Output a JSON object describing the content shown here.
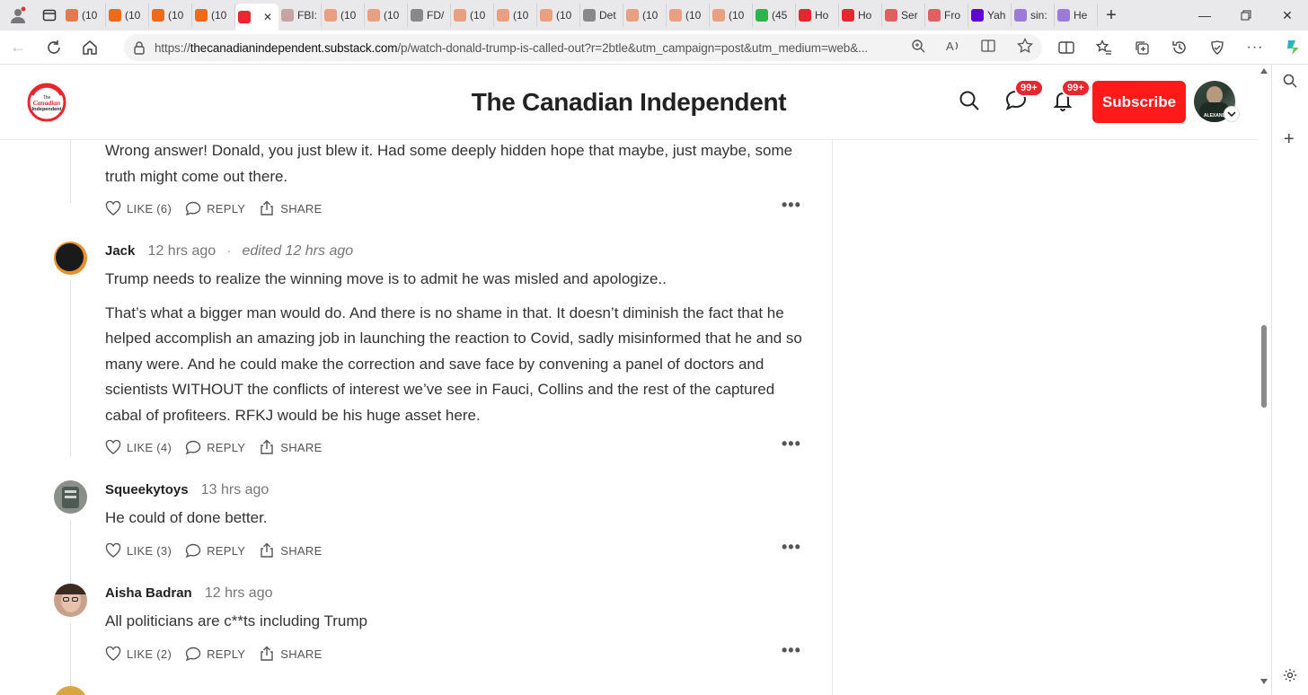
{
  "browser": {
    "tabs": [
      {
        "label": "(10",
        "icon": "substack-icon",
        "color": "#e07a4f"
      },
      {
        "label": "(10",
        "icon": "substack-icon",
        "color": "#f06a1a"
      },
      {
        "label": "(10",
        "icon": "substack-icon",
        "color": "#f06a1a"
      },
      {
        "label": "(10",
        "icon": "substack-icon",
        "color": "#f06a1a"
      },
      {
        "label": "",
        "icon": "canadian-independent-icon",
        "color": "#e8262d",
        "active": true
      },
      {
        "label": "FBI:",
        "icon": "page-icon",
        "color": "#c9a3a3"
      },
      {
        "label": "(10",
        "icon": "substack-icon",
        "color": "#e8a080"
      },
      {
        "label": "(10",
        "icon": "substack-icon",
        "color": "#e8a080"
      },
      {
        "label": "FD/",
        "icon": "link-icon",
        "color": "#888888"
      },
      {
        "label": "(10",
        "icon": "substack-icon",
        "color": "#e8a080"
      },
      {
        "label": "(10",
        "icon": "substack-icon",
        "color": "#e8a080"
      },
      {
        "label": "(10",
        "icon": "substack-icon",
        "color": "#e8a080"
      },
      {
        "label": "Det",
        "icon": "arrow-icon",
        "color": "#888888"
      },
      {
        "label": "(10",
        "icon": "substack-icon",
        "color": "#e8a080"
      },
      {
        "label": "(10",
        "icon": "substack-icon",
        "color": "#e8a080"
      },
      {
        "label": "(10",
        "icon": "substack-icon",
        "color": "#e8a080"
      },
      {
        "label": "(45",
        "icon": "g-icon",
        "color": "#2fb24c"
      },
      {
        "label": "Ho",
        "icon": "red-icon",
        "color": "#e8262d"
      },
      {
        "label": "Ho",
        "icon": "red-icon",
        "color": "#e8262d"
      },
      {
        "label": "Ser",
        "icon": "youtube-icon",
        "color": "#e06060"
      },
      {
        "label": "Fro",
        "icon": "youtube-icon",
        "color": "#e06060"
      },
      {
        "label": "Yah",
        "icon": "yahoo-icon",
        "color": "#6001d2"
      },
      {
        "label": "sin:",
        "icon": "yahoo-icon",
        "color": "#9b7bd6"
      },
      {
        "label": "He",
        "icon": "yahoo-icon",
        "color": "#9b7bd6"
      }
    ],
    "url_prefix": "https://",
    "url_host": "thecanadianindependent.substack.com",
    "url_path": "/p/watch-donald-trump-is-called-out?r=2btle&utm_campaign=post&utm_medium=web&..."
  },
  "header": {
    "title": "The Canadian Independent",
    "logo_lines": [
      "The",
      "Canadian",
      "Independent"
    ],
    "chat_badge": "99+",
    "notif_badge": "99+",
    "subscribe_label": "Subscribe",
    "avatar_caption": "ALEXAND"
  },
  "comments": [
    {
      "name": "",
      "time": "",
      "edited": "",
      "body": [
        "Wrong answer! Donald, you just blew it. Had some deeply hidden hope that maybe, just maybe, some truth might come out there."
      ],
      "like": "LIKE (6)",
      "avatar_color": "#d4a017"
    },
    {
      "name": "Jack",
      "time": "12 hrs ago",
      "edited": "edited 12 hrs ago",
      "body": [
        "Trump needs to realize the winning move is to admit he was misled and apologize..",
        "That’s what a bigger man would do. And there is no shame in that. It doesn’t diminish the fact that he helped accomplish an amazing job in launching the reaction to Covid, sadly misinformed that he and so many were. And he could make the correction and save face by convening a panel of doctors and scientists WITHOUT the conflicts of interest we’ve see in Fauci, Collins and the rest of the captured cabal of profiteers. RFKJ would be his huge asset here."
      ],
      "like": "LIKE (4)",
      "avatar_color": "#1a1a1a"
    },
    {
      "name": "Squeekytoys",
      "time": "13 hrs ago",
      "edited": "",
      "body": [
        "He could of done better."
      ],
      "like": "LIKE (3)",
      "avatar_color": "#8a8f8a"
    },
    {
      "name": "Aisha Badran",
      "time": "12 hrs ago",
      "edited": "",
      "body": [
        "All politicians are c**ts including Trump"
      ],
      "like": "LIKE (2)",
      "avatar_color": "#c9a08a"
    }
  ],
  "actions": {
    "reply": "REPLY",
    "share": "SHARE",
    "more": "•••"
  }
}
